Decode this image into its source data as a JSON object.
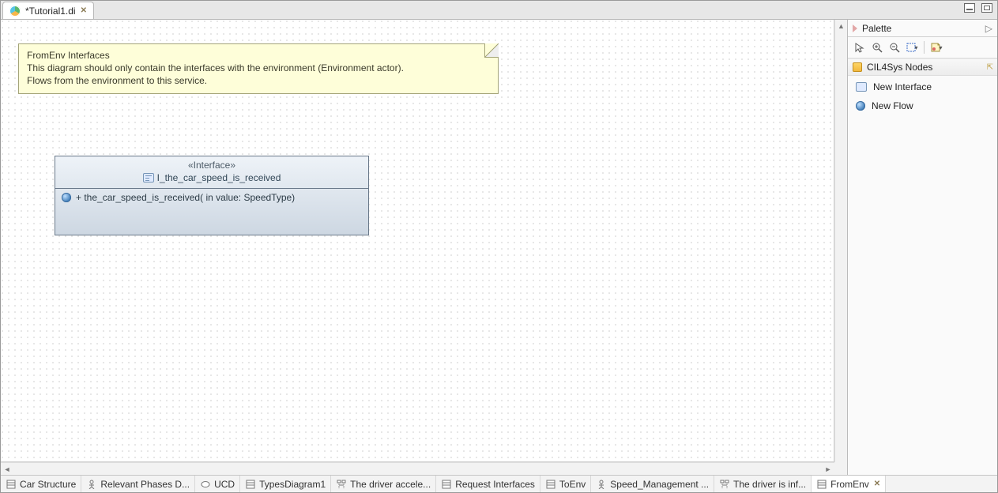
{
  "editor": {
    "tab_title": "*Tutorial1.di"
  },
  "note": {
    "title": "FromEnv Interfaces",
    "line1": "This diagram should only contain the interfaces with the environment (Environment actor).",
    "line2": "Flows from the environment to this service."
  },
  "interface_block": {
    "stereotype": "«Interface»",
    "name": "I_the_car_speed_is_received",
    "operation": "+ the_car_speed_is_received(  in value: SpeedType)"
  },
  "palette": {
    "title": "Palette",
    "drawer": "CIL4Sys Nodes",
    "items": {
      "new_interface": "New Interface",
      "new_flow": "New Flow"
    }
  },
  "view_tabs": [
    {
      "label": "Car Structure"
    },
    {
      "label": "Relevant Phases D..."
    },
    {
      "label": "UCD"
    },
    {
      "label": "TypesDiagram1"
    },
    {
      "label": "The driver accele..."
    },
    {
      "label": "Request Interfaces"
    },
    {
      "label": "ToEnv"
    },
    {
      "label": "Speed_Management ..."
    },
    {
      "label": "The driver is inf..."
    },
    {
      "label": "FromEnv",
      "active": true
    }
  ]
}
